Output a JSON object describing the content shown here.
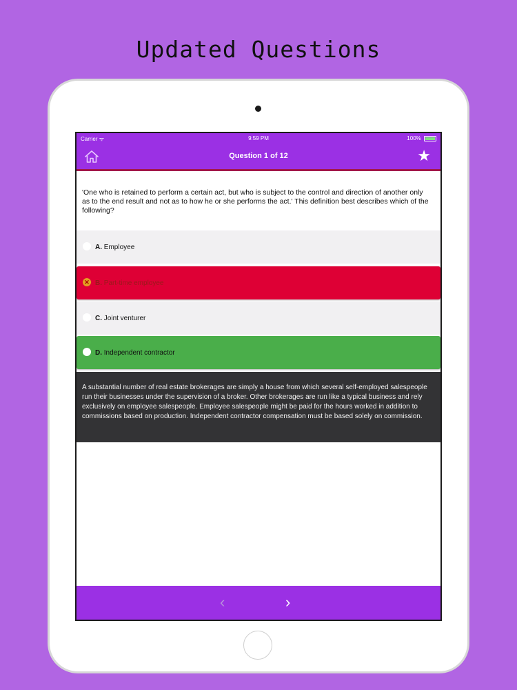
{
  "banner": {
    "title": "Updated Questions"
  },
  "status_bar": {
    "carrier": "Carrier",
    "wifi": "ᯤ",
    "time": "9:59 PM",
    "battery": "100%"
  },
  "nav": {
    "title": "Question 1 of 12",
    "home_icon": "home-icon",
    "star_icon": "star-icon",
    "star_glyph": "★"
  },
  "question": {
    "text": "'One who is retained to perform a certain act, but who is subject to the control and direction of another only as to the end result and not as to how he or she performs the act.' This definition best describes which of the following?"
  },
  "options": [
    {
      "letter": "A.",
      "text": "Employee",
      "state": "neutral"
    },
    {
      "letter": "B.",
      "text": "Part-time employee",
      "state": "wrong",
      "mark": "✕"
    },
    {
      "letter": "C.",
      "text": "Joint venturer",
      "state": "neutral"
    },
    {
      "letter": "D.",
      "text": "Independent contractor",
      "state": "correct"
    }
  ],
  "explanation": {
    "text": "A substantial number of real estate brokerages are simply a house from which several self-employed salespeople run their businesses under the supervision of a broker. Other brokerages are run like a typical business and rely exclusively on employee salespeople. Employee salespeople might be paid for the hours worked in addition to commissions based on production. Independent contractor compensation must be based solely on commission."
  },
  "bottom_nav": {
    "prev_glyph": "‹",
    "next_glyph": "›"
  },
  "colors": {
    "background": "#b165e3",
    "app_purple": "#9b30e4",
    "wrong_red": "#de0035",
    "correct_green": "#4aae4a",
    "explanation_bg": "#333335"
  }
}
